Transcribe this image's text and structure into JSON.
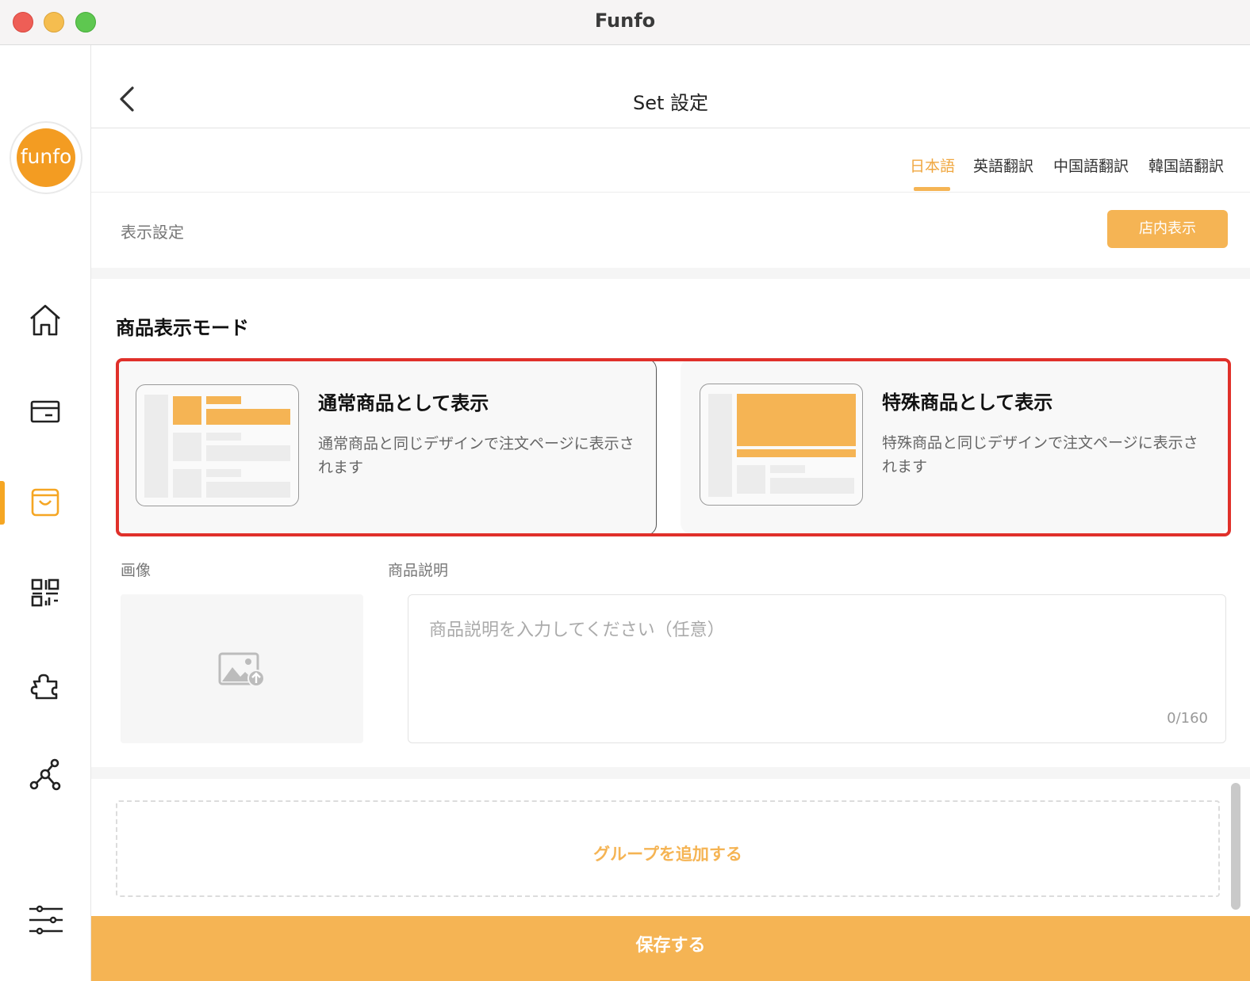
{
  "window": {
    "title": "Funfo"
  },
  "sidebar": {
    "logo_text": "funfo",
    "items": [
      {
        "icon": "home-icon"
      },
      {
        "icon": "card-icon"
      },
      {
        "icon": "shopping-bag-icon",
        "active": true
      },
      {
        "icon": "qr-code-icon"
      },
      {
        "icon": "puzzle-icon"
      },
      {
        "icon": "network-icon"
      },
      {
        "icon": "sliders-icon"
      }
    ]
  },
  "header": {
    "title": "Set 設定",
    "back_icon": "chevron-left-icon"
  },
  "languages": {
    "tabs": [
      "日本語",
      "英語翻訳",
      "中国語翻訳",
      "韓国語翻訳"
    ],
    "active_index": 0
  },
  "display_settings": {
    "label": "表示設定",
    "button_label": "店内表示"
  },
  "mode": {
    "title": "商品表示モード",
    "options": [
      {
        "title": "通常商品として表示",
        "desc": "通常商品と同じデザインで注文ページに表示されます",
        "selected": true
      },
      {
        "title": "特殊商品として表示",
        "desc": "特殊商品と同じデザインで注文ページに表示されます",
        "selected": false
      }
    ]
  },
  "image": {
    "label": "画像",
    "icon": "image-upload-icon"
  },
  "description": {
    "label": "商品説明",
    "placeholder": "商品説明を入力してください（任意）",
    "count": "0/160"
  },
  "add_group": {
    "label": "グループを追加する"
  },
  "save": {
    "label": "保存する"
  },
  "colors": {
    "accent": "#f5b454",
    "highlight": "#e0302a"
  }
}
